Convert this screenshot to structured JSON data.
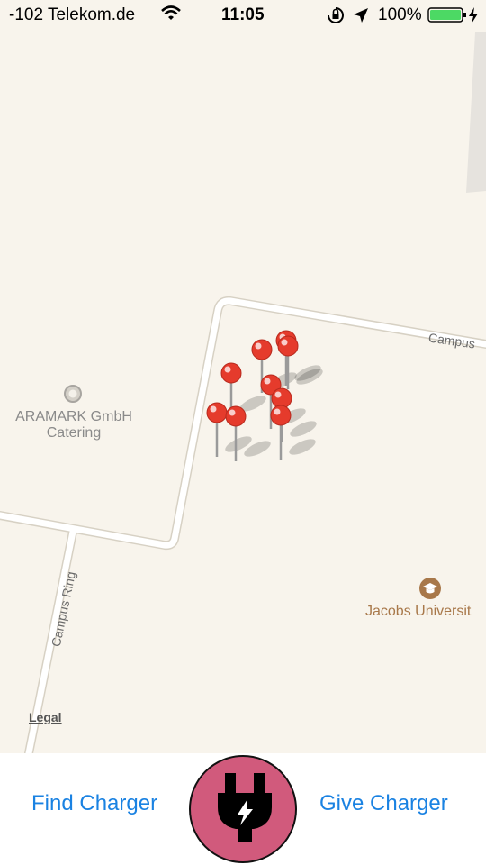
{
  "status_bar": {
    "carrier": "-102 Telekom.de",
    "time": "11:05",
    "battery": "100%",
    "icons": [
      "wifi-icon",
      "rotation-lock-icon",
      "location-arrow-icon",
      "battery-icon",
      "charging-bolt-icon"
    ],
    "battery_color": "#4cd964"
  },
  "map": {
    "pois": [
      {
        "name": "ARAMARK GmbH\nCatering",
        "icon": "poi-circle-icon",
        "color": "#8a8a8a"
      },
      {
        "name": "Jacobs Universit",
        "icon": "graduation-cap-icon",
        "color": "#a8784a"
      }
    ],
    "streets": [
      "Campus",
      "Campus Ring"
    ],
    "legal": "Legal",
    "pin_color": "#e53b2c",
    "pin_count": 9
  },
  "tabbar": {
    "find_label": "Find Charger",
    "give_label": "Give Charger",
    "center_icon": "plug-icon",
    "accent_color": "#1a82e2",
    "center_color": "#d15a7c"
  }
}
